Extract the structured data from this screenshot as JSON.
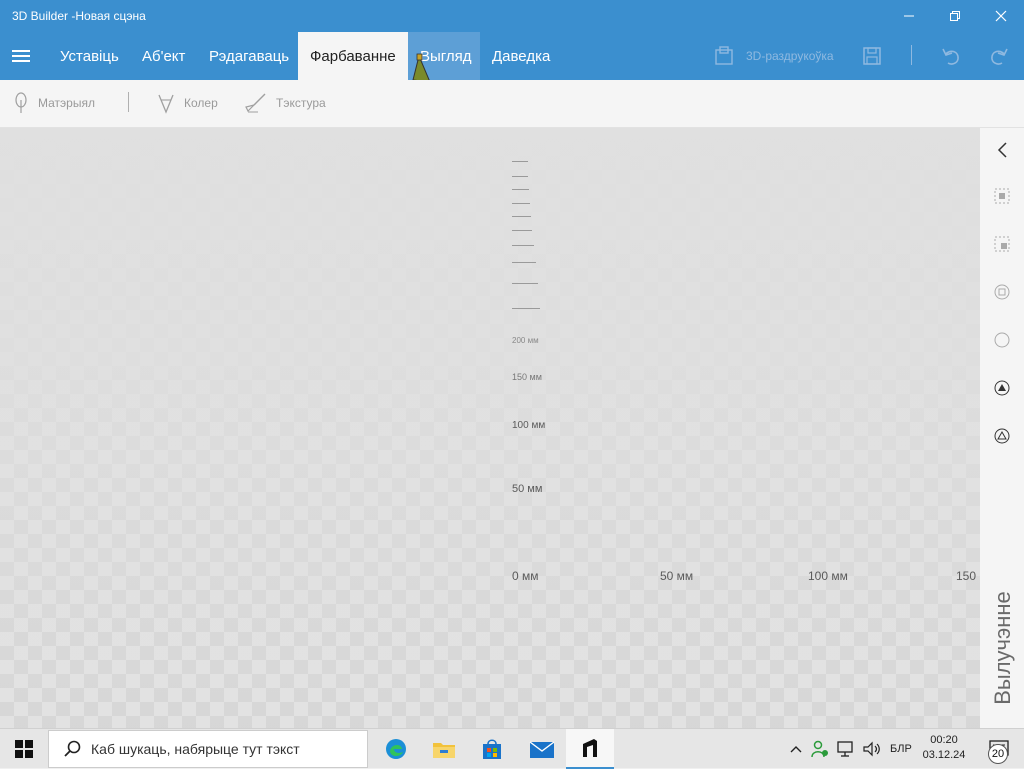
{
  "window": {
    "title": "3D Builder -Новая сцэна"
  },
  "menu": {
    "tabs": [
      {
        "label": "Уставіць"
      },
      {
        "label": "Аб'ект"
      },
      {
        "label": "Рэдагаваць"
      },
      {
        "label": "Фарбаванне"
      },
      {
        "label": "Выгляд"
      },
      {
        "label": "Даведка"
      }
    ],
    "print_label": "3D-раздрукоўка"
  },
  "toolbar": {
    "material_label": "Матэрыял",
    "color_label": "Колер",
    "texture_label": "Тэкстура"
  },
  "viewport": {
    "vertical_ruler": [
      "50 мм",
      "100 мм",
      "150 мм",
      "200 мм"
    ],
    "horizontal_ruler": [
      "0 мм",
      "50 мм",
      "100 мм",
      "150"
    ]
  },
  "side_panel": {
    "label": "Вылучэнне"
  },
  "taskbar": {
    "search_placeholder": "Каб шукаць, набярыце тут тэкст",
    "language": "БЛР",
    "time": "00:20",
    "date": "03.12.24",
    "notification_count": "20"
  },
  "colors": {
    "accent": "#3b8fcf",
    "toolbar_bg": "#f5f5f5",
    "viewport_bg": "#e2e2e2"
  }
}
